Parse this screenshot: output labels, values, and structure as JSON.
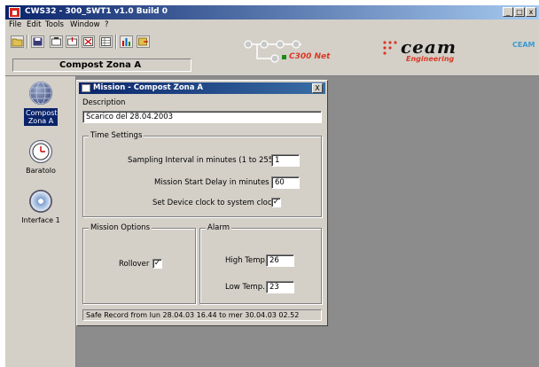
{
  "app": {
    "title": "CWS32 - 300_SWT1 v1.0 Build 0",
    "window_buttons": [
      "_",
      "□",
      "x"
    ]
  },
  "menu": [
    "File",
    "Edit",
    "Tools",
    "Window",
    "?"
  ],
  "toolbar": {
    "zone_label": "Compost Zona A",
    "net_label": "C300 Net",
    "logo_main": "ceam",
    "logo_sub": "Engineering",
    "logo_small": "CEAM"
  },
  "sidebar": {
    "items": [
      {
        "label": "Compost Zona A",
        "icon": "globe-icon",
        "selected": true
      },
      {
        "label": "Baratolo",
        "icon": "clock-device-icon",
        "selected": false
      },
      {
        "label": "Interface 1",
        "icon": "disc-interface-icon",
        "selected": false
      }
    ]
  },
  "dialog": {
    "title": "Mission - Compost Zona A",
    "close_label": "X",
    "description_label": "Description",
    "description_value": "Scarico del 28.04.2003",
    "time_settings": {
      "legend": "Time Settings",
      "sampling_label": "Sampling Interval in minutes (1 to 255)",
      "sampling_value": "1",
      "start_delay_label": "Mission Start Delay in minutes",
      "start_delay_value": "60",
      "clock_label": "Set Device clock to system clock",
      "clock_checked": true
    },
    "mission_options": {
      "legend": "Mission Options",
      "rollover_label": "Rollover",
      "rollover_checked": true
    },
    "alarm": {
      "legend": "Alarm",
      "high_label": "High Temp.",
      "high_value": "26",
      "low_label": "Low Temp.",
      "low_value": "23"
    },
    "status": "Safe Record from lun 28.04.03 16.44 to mer 30.04.03 02.52"
  },
  "colors": {
    "title_bar": "#0a246a",
    "face": "#d4d0c8",
    "workspace": "#8c8c8c",
    "net_accent": "#d83a26"
  }
}
